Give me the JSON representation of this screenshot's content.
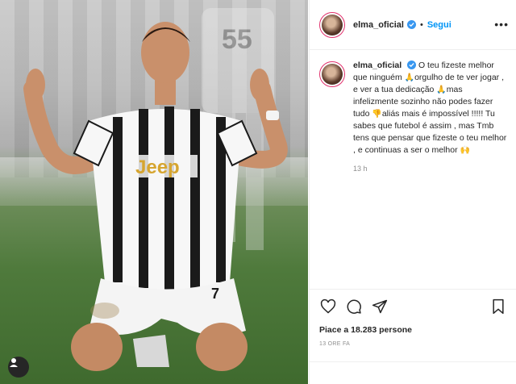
{
  "post": {
    "username": "elma_oficial",
    "follow_label": "Segui",
    "separator": "•",
    "more_label": "•••"
  },
  "caption": {
    "username": "elma_oficial",
    "part1": "O teu fizeste melhor que ninguém",
    "emoji1": "🙏",
    "part2": "orgulho de te ver jogar , e ver a tua dedicação",
    "emoji2": "🙏",
    "part3": "mas infelizmente sozinho não podes fazer tudo",
    "emoji3": "👎",
    "part4": "aliás mais é impossível !!!!! Tu sabes que futebol é assim , mas Tmb tens que pensar que fizeste o teu melhor , e continuas a ser o melhor",
    "emoji4": "🙌",
    "time_ago": "13 h"
  },
  "photo": {
    "jersey_text": "Jeep",
    "shorts_number": "7",
    "bg_player_number": "55"
  },
  "actions": {
    "like_icon": "heart-icon",
    "comment_icon": "comment-icon",
    "share_icon": "share-icon",
    "save_icon": "bookmark-icon",
    "likes_text": "Piace a 18.283 persone",
    "post_time": "13 ORE FA"
  },
  "colors": {
    "follow": "#0095f6",
    "verified": "#3897f0",
    "meta": "#8e8e8e",
    "jersey_stripe": "#1a1a1a",
    "grass": "#4f7a3c"
  }
}
